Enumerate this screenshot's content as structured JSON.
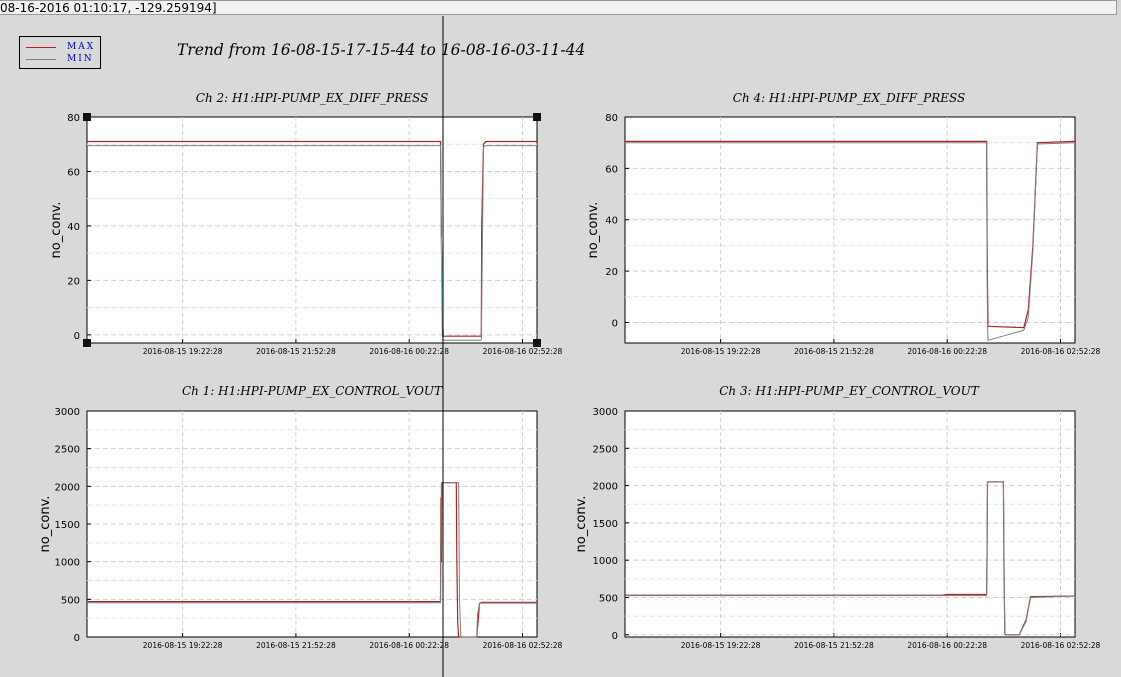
{
  "coordinate_readout": "08-16-2016 01:10:17, -129.259194]",
  "trend_title": "Trend from 16-08-15-17-15-44 to 16-08-16-03-11-44",
  "legend": [
    {
      "label": "MAX",
      "color": "#b22222"
    },
    {
      "label": "MIN",
      "color": "#808080"
    }
  ],
  "colors": {
    "max": "#b22222",
    "min": "#808080",
    "cursor": "#000000",
    "highlight": "#5fc8c8",
    "background": "#d9d9d9",
    "plot_bg": "#ffffff"
  },
  "chart_data": [
    {
      "type": "line",
      "title": "Ch 2: H1:HPI-PUMP_EX_DIFF_PRESS",
      "ylabel": "no_conv.",
      "ylim": [
        -3,
        80
      ],
      "yticks": [
        0,
        20,
        40,
        60,
        80
      ],
      "xlim": [
        0,
        9.93
      ],
      "xtick_positions": [
        2.11,
        4.61,
        7.11,
        9.61
      ],
      "xtick_labels": [
        "2016-08-15 19:22:28",
        "2016-08-15 21:52:28",
        "2016-08-16 00:22:28",
        "2016-08-16 02:52:28"
      ],
      "selected": true,
      "series": [
        {
          "name": "MAX",
          "x": [
            0,
            7.8,
            7.82,
            7.84,
            7.86,
            8.7,
            8.71,
            8.75,
            8.8,
            9.93
          ],
          "y": [
            71,
            71,
            35,
            10,
            -0.5,
            -0.5,
            40,
            70,
            71,
            71
          ]
        },
        {
          "name": "MIN",
          "x": [
            0,
            7.8,
            7.82,
            7.84,
            7.86,
            8.7,
            8.71,
            8.75,
            8.8,
            9.93
          ],
          "y": [
            69.5,
            69.5,
            30,
            0,
            -2,
            -2,
            10,
            69,
            69.5,
            69.5
          ]
        },
        {
          "name": "",
          "x": [
            7.82,
            7.84,
            7.86
          ],
          "y": [
            36,
            15,
            -0.5
          ]
        }
      ]
    },
    {
      "type": "line",
      "title": "Ch 4: H1:HPI-PUMP_EX_DIFF_PRESS",
      "ylabel": "no_conv.",
      "ylim": [
        -8,
        80
      ],
      "yticks": [
        0,
        20,
        40,
        60,
        80
      ],
      "xlim": [
        0,
        9.93
      ],
      "xtick_positions": [
        2.11,
        4.61,
        7.11,
        9.61
      ],
      "xtick_labels": [
        "2016-08-15 19:22:28",
        "2016-08-15 21:52:28",
        "2016-08-16 00:22:28",
        "2016-08-16 02:52:28"
      ],
      "series": [
        {
          "name": "MAX",
          "x": [
            0,
            7.98,
            7.99,
            8.0,
            8.01,
            8.8,
            8.9,
            9.0,
            9.1,
            9.93
          ],
          "y": [
            70.5,
            70.5,
            35,
            15,
            -1.5,
            -2,
            5,
            30,
            70,
            70.5
          ]
        },
        {
          "name": "MIN",
          "x": [
            0,
            7.98,
            7.99,
            8.0,
            8.01,
            8.8,
            8.9,
            9.0,
            9.1,
            9.93
          ],
          "y": [
            70,
            70,
            20,
            0,
            -7,
            -3,
            2,
            28,
            69.5,
            70
          ]
        }
      ]
    },
    {
      "type": "line",
      "title": "Ch 1: H1:HPI-PUMP_EX_CONTROL_VOUT",
      "ylabel": "no_conv.",
      "ylim": [
        0,
        3000
      ],
      "yticks": [
        0,
        500,
        1000,
        1500,
        2000,
        2500,
        3000
      ],
      "xlim": [
        0,
        9.93
      ],
      "xtick_positions": [
        2.11,
        4.61,
        7.11,
        9.61
      ],
      "xtick_labels": [
        "2016-08-15 19:22:28",
        "2016-08-15 21:52:28",
        "2016-08-16 00:22:28",
        "2016-08-16 02:52:28"
      ],
      "series": [
        {
          "name": "MAX",
          "x": [
            0,
            7.8,
            7.81,
            7.82,
            7.83,
            8.15,
            8.16,
            8.18,
            8.2,
            8.6,
            8.63,
            8.66,
            8.7,
            9.93
          ],
          "y": [
            470,
            470,
            1850,
            1000,
            2050,
            2050,
            1050,
            200,
            0,
            0,
            200,
            440,
            460,
            460
          ]
        },
        {
          "name": "MIN",
          "x": [
            0,
            7.8,
            7.82,
            7.84,
            8.2,
            8.22,
            8.25,
            8.6,
            8.62,
            8.66,
            9.93
          ],
          "y": [
            455,
            455,
            2050,
            2050,
            2050,
            500,
            0,
            0,
            300,
            450,
            450
          ]
        }
      ]
    },
    {
      "type": "line",
      "title": "Ch 3: H1:HPI-PUMP_EY_CONTROL_VOUT",
      "ylabel": "no_conv.",
      "ylim": [
        -30,
        3000
      ],
      "yticks": [
        0,
        500,
        1000,
        1500,
        2000,
        2500,
        3000
      ],
      "xlim": [
        0,
        9.93
      ],
      "xtick_positions": [
        2.11,
        4.61,
        7.11,
        9.61
      ],
      "xtick_labels": [
        "2016-08-15 19:22:28",
        "2016-08-15 21:52:28",
        "2016-08-16 00:22:28",
        "2016-08-16 02:52:28"
      ],
      "series": [
        {
          "name": "MAX",
          "x": [
            0,
            7.0,
            7.1,
            7.98,
            7.99,
            8.0,
            8.02,
            8.35,
            8.36,
            8.38,
            8.4,
            8.7,
            8.85,
            8.95,
            9.93
          ],
          "y": [
            530,
            530,
            540,
            540,
            1100,
            2050,
            2050,
            2050,
            1000,
            20,
            0,
            0,
            200,
            510,
            520
          ]
        },
        {
          "name": "MIN",
          "x": [
            0,
            7.98,
            8.0,
            8.35,
            8.38,
            8.4,
            8.7,
            8.85,
            8.95,
            9.93
          ],
          "y": [
            525,
            525,
            2050,
            2050,
            0,
            0,
            0,
            180,
            500,
            520
          ]
        }
      ]
    }
  ]
}
